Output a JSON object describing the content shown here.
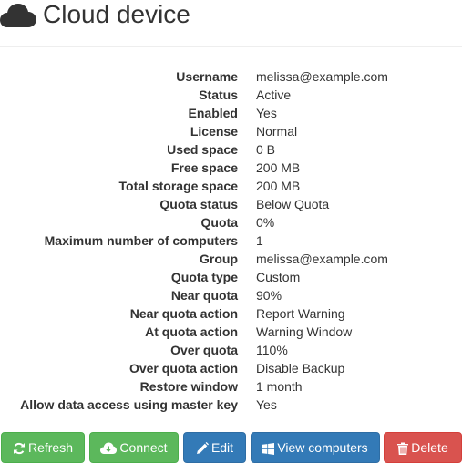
{
  "header": {
    "title": "Cloud device"
  },
  "details": [
    {
      "label": "Username",
      "value": "melissa@example.com"
    },
    {
      "label": "Status",
      "value": "Active"
    },
    {
      "label": "Enabled",
      "value": "Yes"
    },
    {
      "label": "License",
      "value": "Normal"
    },
    {
      "label": "Used space",
      "value": "0 B"
    },
    {
      "label": "Free space",
      "value": "200 MB"
    },
    {
      "label": "Total storage space",
      "value": "200 MB"
    },
    {
      "label": "Quota status",
      "value": "Below Quota"
    },
    {
      "label": "Quota",
      "value": "0%"
    },
    {
      "label": "Maximum number of computers",
      "value": "1"
    },
    {
      "label": "Group",
      "value": "melissa@example.com"
    },
    {
      "label": "Quota type",
      "value": "Custom"
    },
    {
      "label": "Near quota",
      "value": "90%"
    },
    {
      "label": "Near quota action",
      "value": "Report Warning"
    },
    {
      "label": "At quota action",
      "value": "Warning Window"
    },
    {
      "label": "Over quota",
      "value": "110%"
    },
    {
      "label": "Over quota action",
      "value": "Disable Backup"
    },
    {
      "label": "Restore window",
      "value": "1 month"
    },
    {
      "label": "Allow data access using master key",
      "value": "Yes"
    }
  ],
  "toolbar": {
    "refresh": {
      "label": "Refresh",
      "icon": "refresh-icon"
    },
    "connect": {
      "label": "Connect",
      "icon": "cloud-download-icon"
    },
    "edit": {
      "label": "Edit",
      "icon": "pencil-icon"
    },
    "view_computers": {
      "label": "View computers",
      "icon": "windows-icon"
    },
    "delete": {
      "label": "Delete",
      "icon": "trash-icon"
    }
  },
  "colors": {
    "success": "#5cb85c",
    "primary": "#337ab7",
    "danger": "#d9534f",
    "text": "#333333"
  }
}
